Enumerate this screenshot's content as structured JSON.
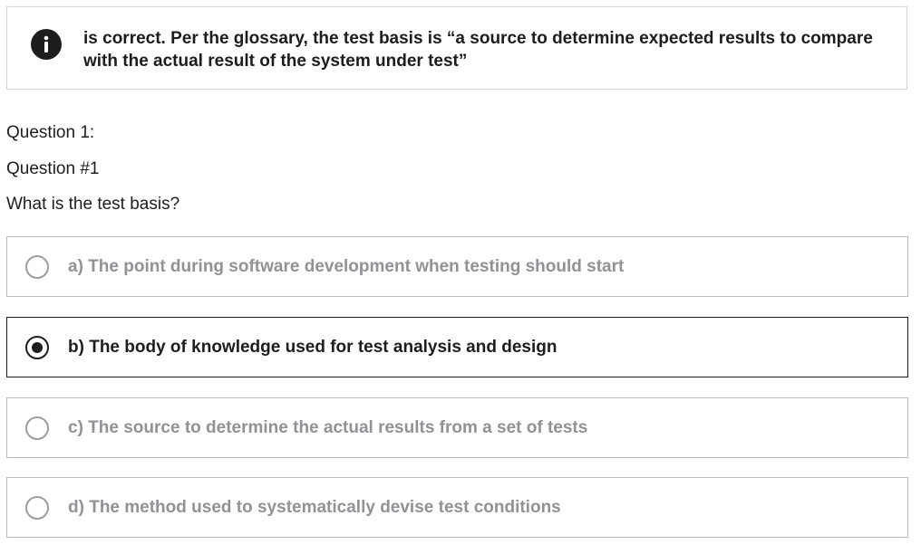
{
  "feedback": {
    "icon": "info-icon",
    "text": "is correct. Per the glossary, the test basis is “a source to determine expected results to compare with the actual result of the system under test”"
  },
  "question": {
    "header": "Question 1:",
    "subheader": "Question #1",
    "prompt": "What is the test basis?"
  },
  "options": [
    {
      "label": "a) The point during software development when testing should start",
      "selected": false
    },
    {
      "label": "b) The body of knowledge used for test analysis and design",
      "selected": true
    },
    {
      "label": "c) The source to determine the actual results from a set of tests",
      "selected": false
    },
    {
      "label": "d) The method used to systematically devise test conditions",
      "selected": false
    }
  ],
  "colors": {
    "text": "#1c1d1f",
    "muted_option_text": "#8f9296",
    "border": "#d1d7dc",
    "option_border": "#b8bcc0",
    "selected_border": "#1c1d1f"
  }
}
